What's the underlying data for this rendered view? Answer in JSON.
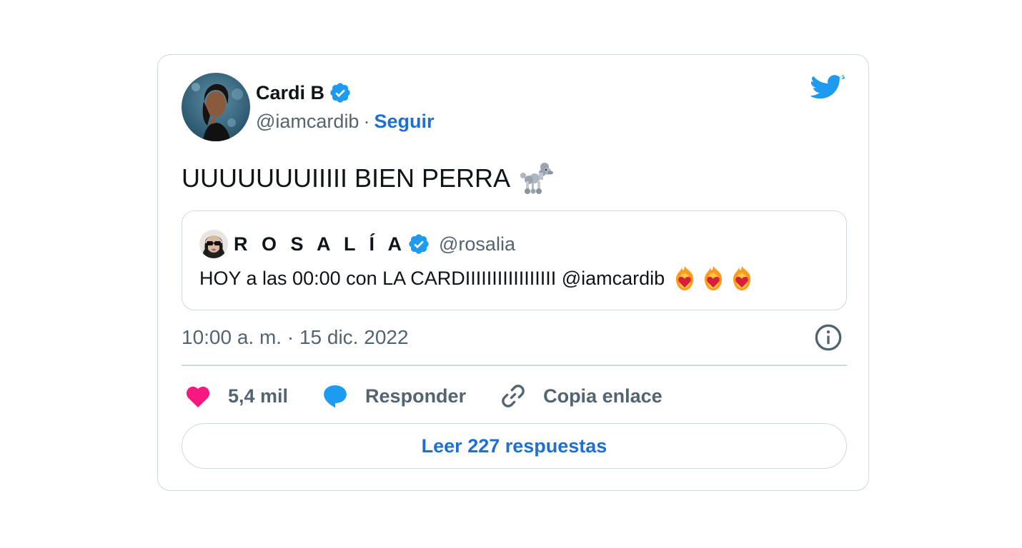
{
  "author": {
    "name": "Cardi B",
    "handle": "@iamcardib",
    "separator": "·",
    "follow_label": "Seguir"
  },
  "tweet": {
    "text": "UUUUUUUIIIII BIEN PERRA",
    "emoji": "poodle-icon"
  },
  "quoted": {
    "name": "R O S A L Í A",
    "handle": "@rosalia",
    "text": "HOY a las 00:00 con LA CARDIIIIIIIIIIIIIIIII @iamcardib",
    "emojis": [
      "heart-on-fire-icon",
      "heart-on-fire-icon",
      "heart-on-fire-icon"
    ]
  },
  "timestamp": "10:00 a. m. · 15 dic. 2022",
  "actions": {
    "likes": "5,4 mil",
    "reply": "Responder",
    "copy_link": "Copia enlace"
  },
  "read_replies": "Leer 227 respuestas",
  "colors": {
    "accent": "#1d9bf0",
    "link": "#1d6fd1",
    "like": "#f91880",
    "border": "#cfd9de",
    "secondary_text": "#536471"
  }
}
